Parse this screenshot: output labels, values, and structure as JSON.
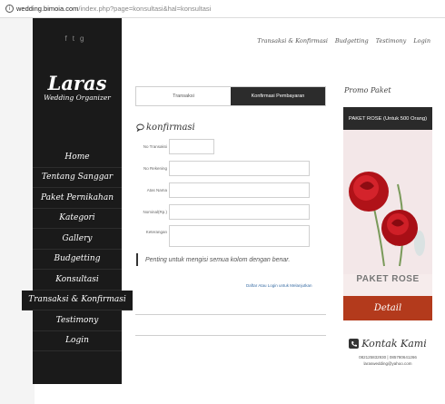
{
  "browser": {
    "url_host": "wedding.bimoia.com",
    "url_path": "/index.php?page=konsultasi&hal=konsultasi"
  },
  "sidebar": {
    "social": [
      "f",
      "t",
      "g"
    ],
    "logo_main": "Laras",
    "logo_sub": "Wedding Organizer",
    "nav": [
      {
        "label": "Home"
      },
      {
        "label": "Tentang Sanggar"
      },
      {
        "label": "Paket Pernikahan"
      },
      {
        "label": "Kategori"
      },
      {
        "label": "Gallery"
      },
      {
        "label": "Budgetting"
      },
      {
        "label": "Konsultasi"
      },
      {
        "label": "Transaksi & Konfirmasi"
      },
      {
        "label": "Testimony"
      },
      {
        "label": "Login"
      }
    ]
  },
  "topmenu": [
    "Transaksi & Konfirmasi",
    "Budgetting",
    "Testimony",
    "Login"
  ],
  "tabs": [
    {
      "label": "Transaksi",
      "active": false
    },
    {
      "label": "Konfirmasi Pembayaran",
      "active": true
    }
  ],
  "form": {
    "title": "konfirmasi",
    "fields": [
      {
        "label": "No Transaksi",
        "value": ""
      },
      {
        "label": "No Rekening",
        "value": ""
      },
      {
        "label": "Atas Nama",
        "value": ""
      },
      {
        "label": "Nominal(Rp.)",
        "value": ""
      },
      {
        "label": "Keterangan",
        "value": ""
      }
    ],
    "note": "Penting untuk mengisi semua kolom dengan benar.",
    "daftar_link": "Daftar Atau Login untuk Melanjutkan"
  },
  "promo": {
    "title": "Promo Paket",
    "header": "PAKET ROSE (Untuk 500 Orang)",
    "caption": "PAKET ROSE",
    "button": "Detail",
    "accent": "#b33a1c"
  },
  "kontak": {
    "title": "Kontak Kami",
    "phone": "082125832930 | 085780641266",
    "email": "laraswedding@yahoo.com"
  }
}
